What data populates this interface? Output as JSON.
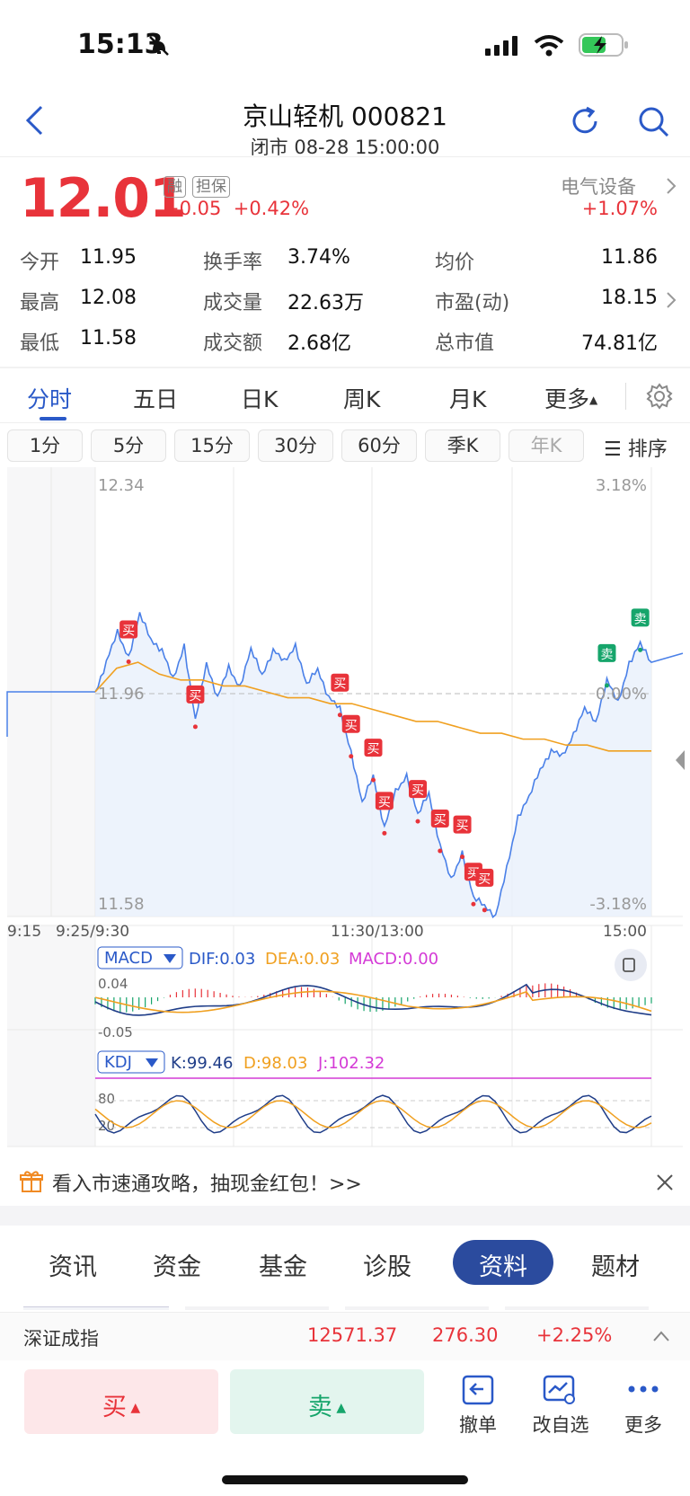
{
  "status_bar": {
    "time": "15:13",
    "icons": [
      "bell-slash-icon",
      "signal-icon",
      "wifi-icon",
      "battery-charging-icon"
    ]
  },
  "header": {
    "title": "京山轻机 000821",
    "subtitle": "闭市 08-28 15:00:00",
    "icons": [
      "back-chevron-icon",
      "refresh-icon",
      "search-icon"
    ]
  },
  "quote": {
    "price": "12.01",
    "tags": [
      "融",
      "担保"
    ],
    "change": "+0.05",
    "change_pct": "+0.42%",
    "sector": "电气设备",
    "sector_change": "+1.07%",
    "stats": [
      {
        "label": "今开",
        "value": "11.95"
      },
      {
        "label": "换手率",
        "value": "3.74%"
      },
      {
        "label": "均价",
        "value": "11.86"
      },
      {
        "label": "最高",
        "value": "12.08"
      },
      {
        "label": "成交量",
        "value": "22.63万"
      },
      {
        "label": "市盈(动)",
        "value": "18.15"
      },
      {
        "label": "最低",
        "value": "11.58"
      },
      {
        "label": "成交额",
        "value": "2.68亿"
      },
      {
        "label": "总市值",
        "value": "74.81亿"
      }
    ]
  },
  "period_tabs": [
    "分时",
    "五日",
    "日K",
    "周K",
    "月K",
    "更多"
  ],
  "kline_tabs": [
    "1分",
    "5分",
    "15分",
    "30分",
    "60分",
    "季K",
    "年K"
  ],
  "sort_label": "排序",
  "chart_data": {
    "type": "line",
    "price_axis": {
      "top": "12.34",
      "mid": "11.96",
      "bottom": "11.58"
    },
    "pct_axis": {
      "top": "3.18%",
      "mid": "0.00%",
      "bottom": "-3.18%"
    },
    "time_labels": [
      "9:15",
      "9:25/9:30",
      "11:30/13:00",
      "15:00"
    ],
    "series": [
      {
        "values": [
          11.96,
          12.01,
          12.06,
          12.02,
          12.09,
          12.05,
          12.03,
          11.98,
          12.04,
          11.91,
          12.01,
          11.95,
          12.0,
          11.97,
          12.03,
          11.99,
          12.03,
          12.01,
          12.04,
          11.97,
          12.0,
          11.95,
          11.93,
          11.86,
          11.77,
          11.82,
          11.73,
          11.79,
          11.82,
          11.75,
          11.79,
          11.7,
          11.64,
          11.69,
          11.61,
          11.6,
          11.58,
          11.66,
          11.75,
          11.78,
          11.83,
          11.86,
          11.85,
          11.89,
          11.93,
          11.91,
          11.98,
          11.94,
          12.01,
          12.04,
          12.01
        ]
      },
      {
        "values": [
          11.96,
          12.0,
          12.01,
          11.99,
          11.98,
          11.98,
          11.97,
          11.97,
          11.96,
          11.95,
          11.95,
          11.94,
          11.94,
          11.93,
          11.92,
          11.91,
          11.91,
          11.9,
          11.89,
          11.89,
          11.88,
          11.88,
          11.87,
          11.87,
          11.86,
          11.86,
          11.86
        ]
      }
    ],
    "markers": [
      {
        "label": "买",
        "color": "#e8333a"
      },
      {
        "label": "卖",
        "color": "#16a56b"
      }
    ],
    "macd": {
      "name": "MACD",
      "dif": "DIF:0.03",
      "dea": "DEA:0.03",
      "macd": "MACD:0.00",
      "top": "0.04",
      "bottom": "-0.05"
    },
    "kdj": {
      "name": "KDJ",
      "k": "K:99.46",
      "d": "D:98.03",
      "j": "J:102.32",
      "t80": "80",
      "t20": "20"
    }
  },
  "banner": {
    "text": "看入市速通攻略，抽现金红包！>>"
  },
  "info_tabs": [
    "资讯",
    "资金",
    "基金",
    "诊股",
    "资料",
    "题材"
  ],
  "index_bar": {
    "name": "深证成指",
    "value": "12571.37",
    "change": "276.30",
    "change_pct": "+2.25%"
  },
  "actions": {
    "buy": "买",
    "sell": "卖",
    "cancel": "撤单",
    "edit_watch": "改自选",
    "more": "更多"
  },
  "colors": {
    "up": "#e8333a",
    "down": "#16a56b",
    "accent": "#2a59c8",
    "avg_line": "#f0a020",
    "price_line": "#4a80e8"
  }
}
